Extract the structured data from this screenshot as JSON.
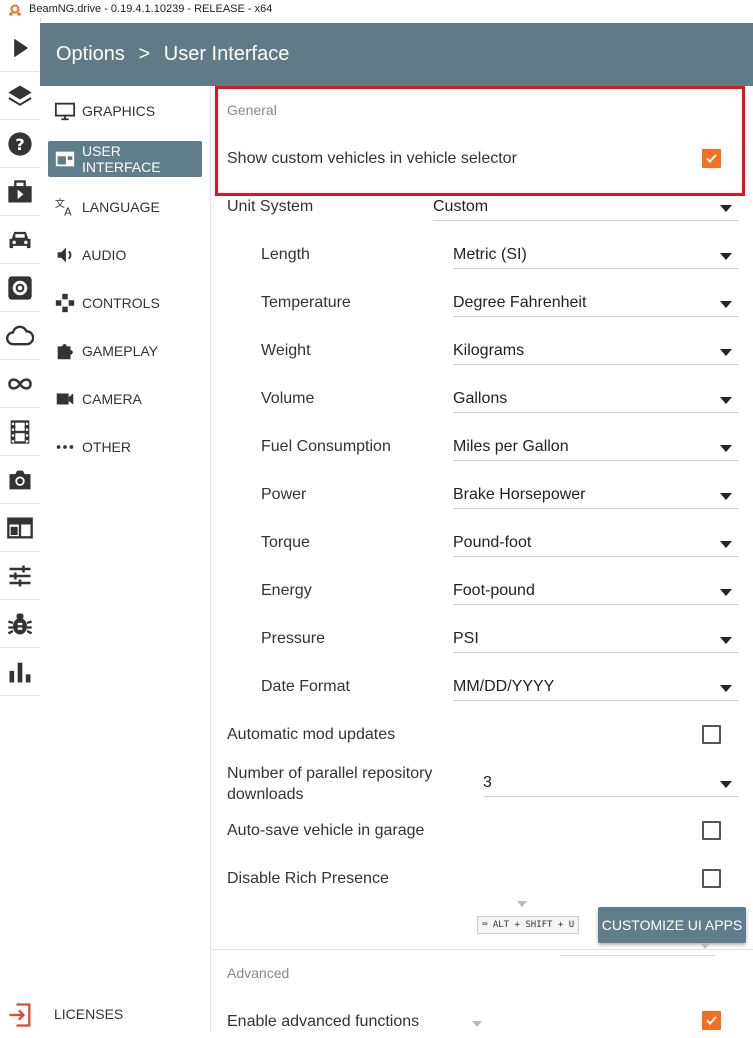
{
  "window": {
    "title": "BeamNG.drive - 0.19.4.1.10239 - RELEASE - x64"
  },
  "iconbar": {
    "items": [
      "play-icon",
      "layers-icon",
      "help-icon",
      "career-icon",
      "car-icon",
      "gear-icon",
      "cloud-icon",
      "infinity-icon",
      "film-icon",
      "camera-icon",
      "ui-apps-icon",
      "sliders-icon",
      "bug-icon",
      "chart-icon"
    ],
    "exit": "exit-icon"
  },
  "header": {
    "section": "Options",
    "separator": ">",
    "page": "User Interface"
  },
  "nav": {
    "items": [
      {
        "label": "GRAPHICS",
        "icon": "monitor-icon"
      },
      {
        "label": "USER INTERFACE",
        "icon": "ui-icon",
        "active": true
      },
      {
        "label": "LANGUAGE",
        "icon": "translate-icon"
      },
      {
        "label": "AUDIO",
        "icon": "speaker-icon"
      },
      {
        "label": "CONTROLS",
        "icon": "gamepad-icon"
      },
      {
        "label": "GAMEPLAY",
        "icon": "puzzle-icon"
      },
      {
        "label": "CAMERA",
        "icon": "videocam-icon"
      },
      {
        "label": "OTHER",
        "icon": "more-icon"
      }
    ],
    "licenses": "LICENSES"
  },
  "general": {
    "label": "General",
    "custom_vehicles": {
      "label": "Show custom vehicles in vehicle selector",
      "checked": true
    },
    "unit_system": {
      "label": "Unit System",
      "value": "Custom"
    },
    "units": [
      {
        "label": "Length",
        "value": "Metric (SI)"
      },
      {
        "label": "Temperature",
        "value": "Degree Fahrenheit"
      },
      {
        "label": "Weight",
        "value": "Kilograms"
      },
      {
        "label": "Volume",
        "value": "Gallons"
      },
      {
        "label": "Fuel Consumption",
        "value": "Miles per Gallon"
      },
      {
        "label": "Power",
        "value": "Brake Horsepower"
      },
      {
        "label": "Torque",
        "value": "Pound-foot"
      },
      {
        "label": "Energy",
        "value": "Foot-pound"
      },
      {
        "label": "Pressure",
        "value": "PSI"
      },
      {
        "label": "Date Format",
        "value": "MM/DD/YYYY"
      }
    ],
    "auto_mod_updates": {
      "label": "Automatic mod updates",
      "checked": false
    },
    "parallel_downloads": {
      "label": "Number of parallel repository downloads",
      "value": "3"
    },
    "autosave_garage": {
      "label": "Auto-save vehicle in garage",
      "checked": false
    },
    "rich_presence": {
      "label": "Disable Rich Presence",
      "checked": false
    },
    "shortcut_hint": "ALT + SHIFT + U",
    "customize_button": "CUSTOMIZE UI APPS"
  },
  "advanced": {
    "label": "Advanced",
    "enable_advanced": {
      "label": "Enable advanced functions",
      "checked": true
    }
  },
  "colors": {
    "header": "#617a88",
    "accent": "#f36f21",
    "active_nav": "#607d8b",
    "highlight": "#e0141e"
  }
}
